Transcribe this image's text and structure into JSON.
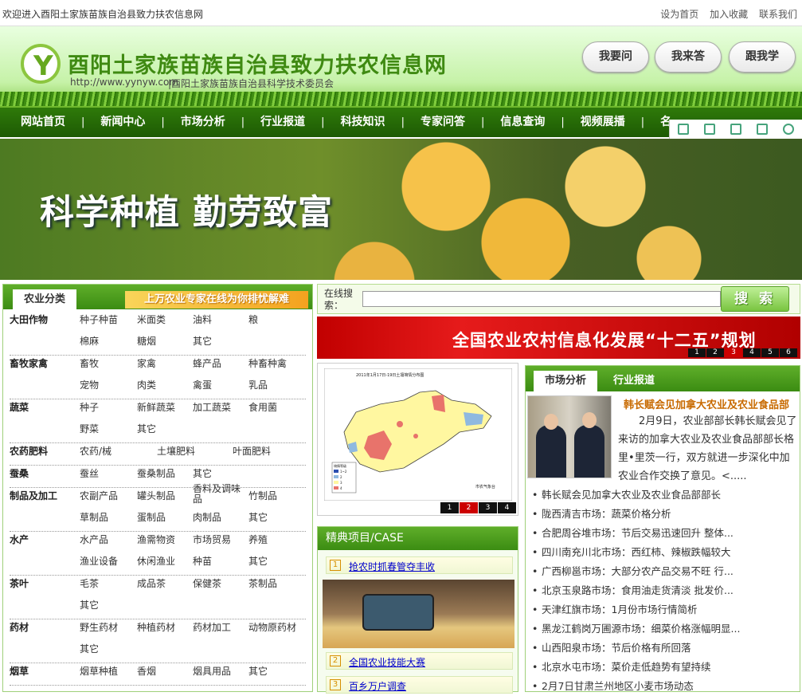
{
  "topbar": {
    "welcome": "欢迎进入酉阳土家族苗族自治县致力扶农信息网",
    "links": [
      "设为首页",
      "加入收藏",
      "联系我们"
    ]
  },
  "header": {
    "logo_letter": "Y",
    "title": "酉阳土家族苗族自治县致力扶农信息网",
    "url": "http://www.yynyw.com",
    "sub": "|酉阳土家族苗族自治县科学技术委员会",
    "buttons": [
      "我要问",
      "我来答",
      "跟我学"
    ]
  },
  "nav": {
    "items": [
      "网站首页",
      "新闻中心",
      "市场分析",
      "行业报道",
      "科技知识",
      "专家问答",
      "信息查询",
      "视频展播",
      "名"
    ],
    "sep": "|"
  },
  "banner": {
    "slogan": "科学种植  勤劳致富"
  },
  "left": {
    "tab": "农业分类",
    "promo": "上万农业专家在线为你排忧解难",
    "categories": [
      {
        "name": "大田作物",
        "rows": [
          [
            "种子种苗",
            "米面类",
            "油料",
            "粮"
          ],
          [
            "棉麻",
            "糖烟",
            "其它"
          ]
        ]
      },
      {
        "name": "畜牧家禽",
        "rows": [
          [
            "畜牧",
            "家禽",
            "蜂产品",
            "种畜种禽"
          ],
          [
            "宠物",
            "肉类",
            "禽蛋",
            "乳品"
          ]
        ]
      },
      {
        "name": "蔬菜",
        "rows": [
          [
            "种子",
            "新鲜蔬菜",
            "加工蔬菜",
            "食用菌"
          ],
          [
            "野菜",
            "其它"
          ]
        ]
      },
      {
        "name": "农药肥料",
        "rows": [
          [
            "农药/械",
            "土壤肥料",
            "叶面肥料"
          ]
        ]
      },
      {
        "name": "蚕桑",
        "rows": [
          [
            "蚕丝",
            "蚕桑制品",
            "其它"
          ]
        ]
      },
      {
        "name": "制品及加工",
        "rows": [
          [
            "农副产品",
            "罐头制品",
            "香料及调味品",
            "竹制品"
          ],
          [
            "草制品",
            "蛋制品",
            "肉制品",
            "其它"
          ]
        ]
      },
      {
        "name": "水产",
        "rows": [
          [
            "水产品",
            "渔需物资",
            "市场贸易",
            "养殖"
          ],
          [
            "渔业设备",
            "休闲渔业",
            "种苗",
            "其它"
          ]
        ]
      },
      {
        "name": "茶叶",
        "rows": [
          [
            "毛茶",
            "成品茶",
            "保健茶",
            "茶制品"
          ],
          [
            "其它"
          ]
        ]
      },
      {
        "name": "药材",
        "rows": [
          [
            "野生药材",
            "种植药材",
            "药材加工",
            "动物原药材"
          ],
          [
            "其它"
          ]
        ]
      },
      {
        "name": "烟草",
        "rows": [
          [
            "烟草种植",
            "香烟",
            "烟具用品",
            "其它"
          ]
        ]
      }
    ]
  },
  "search": {
    "label": "在线搜索：",
    "button": "搜 索",
    "value": ""
  },
  "ad": {
    "text": "全国农业农村信息化发展“十二五”规划",
    "pages": [
      "1",
      "2",
      "3",
      "4",
      "5",
      "6"
    ]
  },
  "map": {
    "pages": [
      "1",
      "2",
      "3",
      "4"
    ],
    "title": "2011年1月17日-19日土壤墒情分布图",
    "legend_title": "墒情等级",
    "legend": [
      "1~2",
      "2",
      "3",
      "4"
    ],
    "credit": "市农气象台"
  },
  "cases": {
    "title": "精典项目/CASE",
    "items": [
      {
        "num": "1",
        "text": "抢农时抓春管夺丰收"
      },
      {
        "num": "2",
        "text": "全国农业技能大赛"
      },
      {
        "num": "3",
        "text": "百乡万户调查"
      }
    ]
  },
  "news": {
    "tabs": [
      "市场分析",
      "行业报道"
    ],
    "feature_title": "韩长赋会见加拿大农业及农业食品部",
    "feature_body": "2月9日，农业部部长韩长赋会见了来访的加拿大农业及农业食品部部长格里•里茨一行，双方就进一步深化中加农业合作交换了意见。<.....",
    "items": [
      "韩长赋会见加拿大农业及农业食品部部长",
      "陇西清吉市场：蔬菜价格分析",
      "合肥周谷堆市场：节后交易迅速回升 整体...",
      "四川南充川北市场：西红柿、辣椒跌幅较大",
      "广西柳邕市场：大部分农产品交易不旺 行...",
      "北京玉泉路市场：食用油走货清淡 批发价...",
      "天津红旗市场：1月份市场行情简析",
      "黑龙江鹤岗万圃源市场：细菜价格涨幅明显...",
      "山西阳泉市场：节后价格有所回落",
      "北京水屯市场：菜价走低趋势有望持续",
      "2月7日甘肃兰州地区小麦市场动态"
    ]
  }
}
